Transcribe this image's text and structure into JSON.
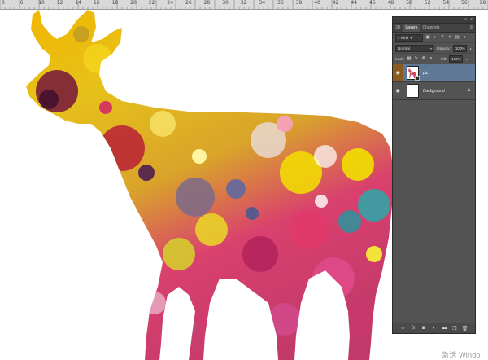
{
  "ruler": {
    "labels": [
      "0",
      "6",
      "10",
      "12",
      "14",
      "16",
      "18",
      "20",
      "22",
      "24",
      "26",
      "28",
      "30",
      "32",
      "34",
      "36",
      "38",
      "40",
      "42",
      "44",
      "46",
      "48",
      "50",
      "52",
      "54",
      "56",
      "58"
    ]
  },
  "panel": {
    "title_controls": {
      "collapse": "«",
      "close": "×"
    },
    "tabs": [
      {
        "label": "3D",
        "active": false
      },
      {
        "label": "Layers",
        "active": true
      },
      {
        "label": "Channels",
        "active": false
      }
    ],
    "menu_icon": "panel-menu-icon",
    "filter": {
      "kind_label": "Kind"
    },
    "blend": {
      "mode": "Normal",
      "opacity_label": "Opacity:",
      "opacity_value": "100%"
    },
    "lock": {
      "label": "Lock:",
      "fill_label": "Fill:",
      "fill_value": "100%"
    },
    "layers": [
      {
        "name": "pic",
        "selected": true,
        "visible": true
      },
      {
        "name": "Background",
        "selected": false,
        "visible": true,
        "locked": true
      }
    ]
  },
  "watermark": {
    "text": "激活 Windo"
  },
  "colors": {
    "panel_bg": "#535353",
    "selected_layer": "#5f7896",
    "eye_highlight": "#8a5a1e",
    "canvas_bg": "#ffffff"
  }
}
